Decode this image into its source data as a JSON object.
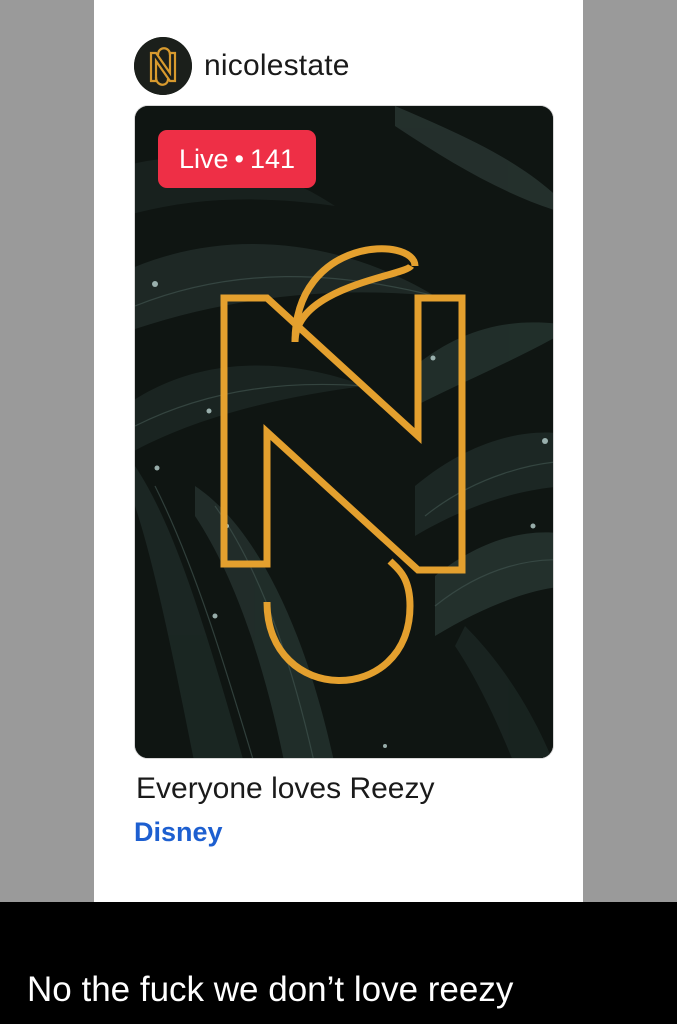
{
  "post": {
    "username": "nicolestate",
    "live_badge": {
      "label": "Live",
      "separator": "•",
      "viewers": "141"
    },
    "caption": "Everyone loves Reezy",
    "subcaption": "Disney"
  },
  "meme": {
    "text": "No the fuck we don’t love reezy"
  },
  "icons": {
    "avatar": "ns-monogram-logo",
    "card_art": "ns-monogram-logo"
  },
  "colors": {
    "live_red": "#ee2f46",
    "link_blue": "#1d5fd0",
    "gold": "#e8a52f",
    "bar_gray": "#9a9a9a"
  }
}
